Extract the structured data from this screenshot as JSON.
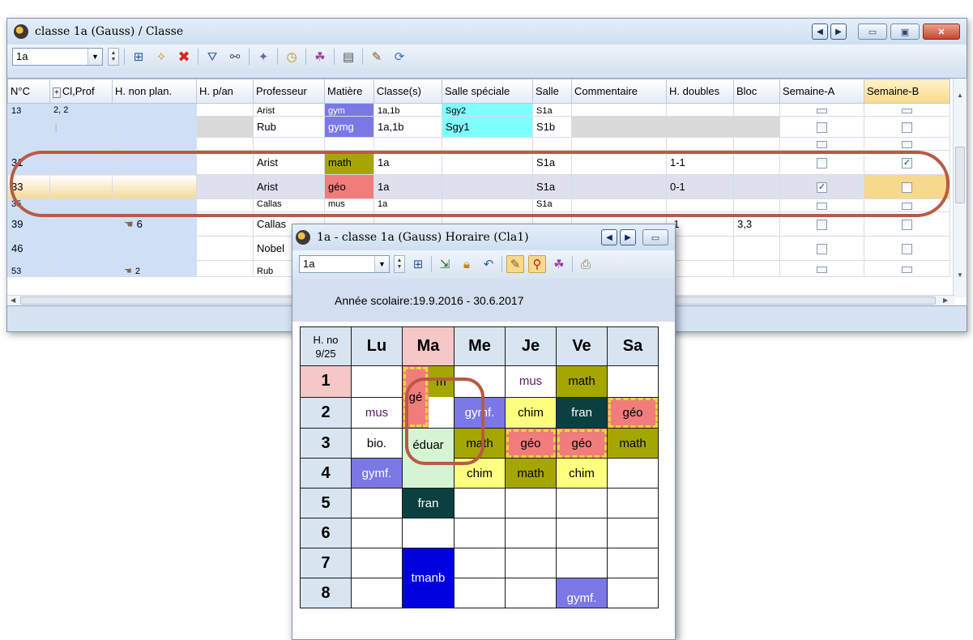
{
  "main_window": {
    "title": "classe 1a (Gauss) / Classe",
    "class_combo": "1a",
    "columns": [
      "N°C",
      "Cl,Prof",
      "H. non plan.",
      "H. p/an",
      "Professeur",
      "Matière",
      "Classe(s)",
      "Salle spéciale",
      "Salle",
      "Commentaire",
      "H. doubles",
      "Bloc",
      "Semaine-A",
      "Semaine-B"
    ],
    "rows": [
      {
        "no": "13",
        "cl": "2, 2",
        "hnp": "",
        "prof": "Arist",
        "subj": "gym",
        "classes": "1a,1b",
        "special": "Sgy2",
        "room": "S1a",
        "dbl": "",
        "bloc": "",
        "semA": false,
        "semB": false
      },
      {
        "no": "",
        "cl": "",
        "hnp": "",
        "prof": "Rub",
        "subj": "gymg",
        "classes": "1a,1b",
        "special": "Sgy1",
        "room": "S1b",
        "dbl": "",
        "bloc": "",
        "semA": false,
        "semB": false
      },
      {
        "no": "",
        "cl": "",
        "hnp": "",
        "prof": "",
        "subj": "",
        "classes": "",
        "special": "",
        "room": "",
        "dbl": "",
        "bloc": "",
        "semA": false,
        "semB": false
      },
      {
        "no": "31",
        "cl": "",
        "hnp": "",
        "prof": "Arist",
        "subj": "math",
        "classes": "1a",
        "special": "",
        "room": "S1a",
        "dbl": "1-1",
        "bloc": "",
        "semA": false,
        "semB": true
      },
      {
        "no": "33",
        "cl": "",
        "hnp": "",
        "prof": "Arist",
        "subj": "géo",
        "classes": "1a",
        "special": "",
        "room": "S1a",
        "dbl": "0-1",
        "bloc": "",
        "semA": true,
        "semB": false
      },
      {
        "no": "35",
        "cl": "",
        "hnp": "",
        "prof": "Callas",
        "subj": "mus",
        "classes": "1a",
        "special": "",
        "room": "S1a",
        "dbl": "",
        "bloc": "",
        "semA": false,
        "semB": false
      },
      {
        "no": "39",
        "cl": "",
        "hnp": "6",
        "prof": "Callas",
        "subj": "",
        "classes": "",
        "special": "",
        "room": "",
        "dbl": "-1",
        "bloc": "3,3",
        "semA": false,
        "semB": false
      },
      {
        "no": "46",
        "cl": "",
        "hnp": "",
        "prof": "Nobel",
        "subj": "",
        "classes": "",
        "special": "",
        "room": "",
        "dbl": "",
        "bloc": "",
        "semA": false,
        "semB": false
      },
      {
        "no": "53",
        "cl": "",
        "hnp": "2",
        "prof": "Rub",
        "subj": "",
        "classes": "",
        "special": "",
        "room": "",
        "dbl": "",
        "bloc": "",
        "semA": false,
        "semB": false
      }
    ]
  },
  "timetable_window": {
    "title": "1a - classe 1a (Gauss)  Horaire  (Cla1)",
    "class_combo": "1a",
    "school_year": "Année scolaire:19.9.2016 - 30.6.2017",
    "corner_line1": "H. no",
    "corner_line2": "9/25",
    "days": [
      "Lu",
      "Ma",
      "Me",
      "Je",
      "Ve",
      "Sa"
    ],
    "periods": [
      "1",
      "2",
      "3",
      "4",
      "5",
      "6",
      "7",
      "8"
    ],
    "cells": {
      "ma_geo": "gé",
      "ma_m": "m",
      "je1": "mus",
      "ve1": "math",
      "lu2": "mus",
      "me2": "gymf.",
      "je2": "chim",
      "ve2": "fran",
      "sa2": "géo",
      "lu3": "bio.",
      "ma34": "éduar",
      "me3": "math",
      "je3": "géo",
      "ve3": "géo",
      "sa3": "math",
      "lu4": "gymf.",
      "me4": "chim",
      "je4": "math",
      "ve4": "chim",
      "ma5": "fran",
      "ma78": "tmanb",
      "ve8": "gymf."
    }
  },
  "colors": {
    "math": "#a6a600",
    "geo": "#f07c7c",
    "gymf": "#7b78e6",
    "chim": "#ffff80",
    "fran": "#0c4040",
    "tman": "#0000e0",
    "special_room": "#80ffff",
    "annotation": "#b85a45"
  }
}
